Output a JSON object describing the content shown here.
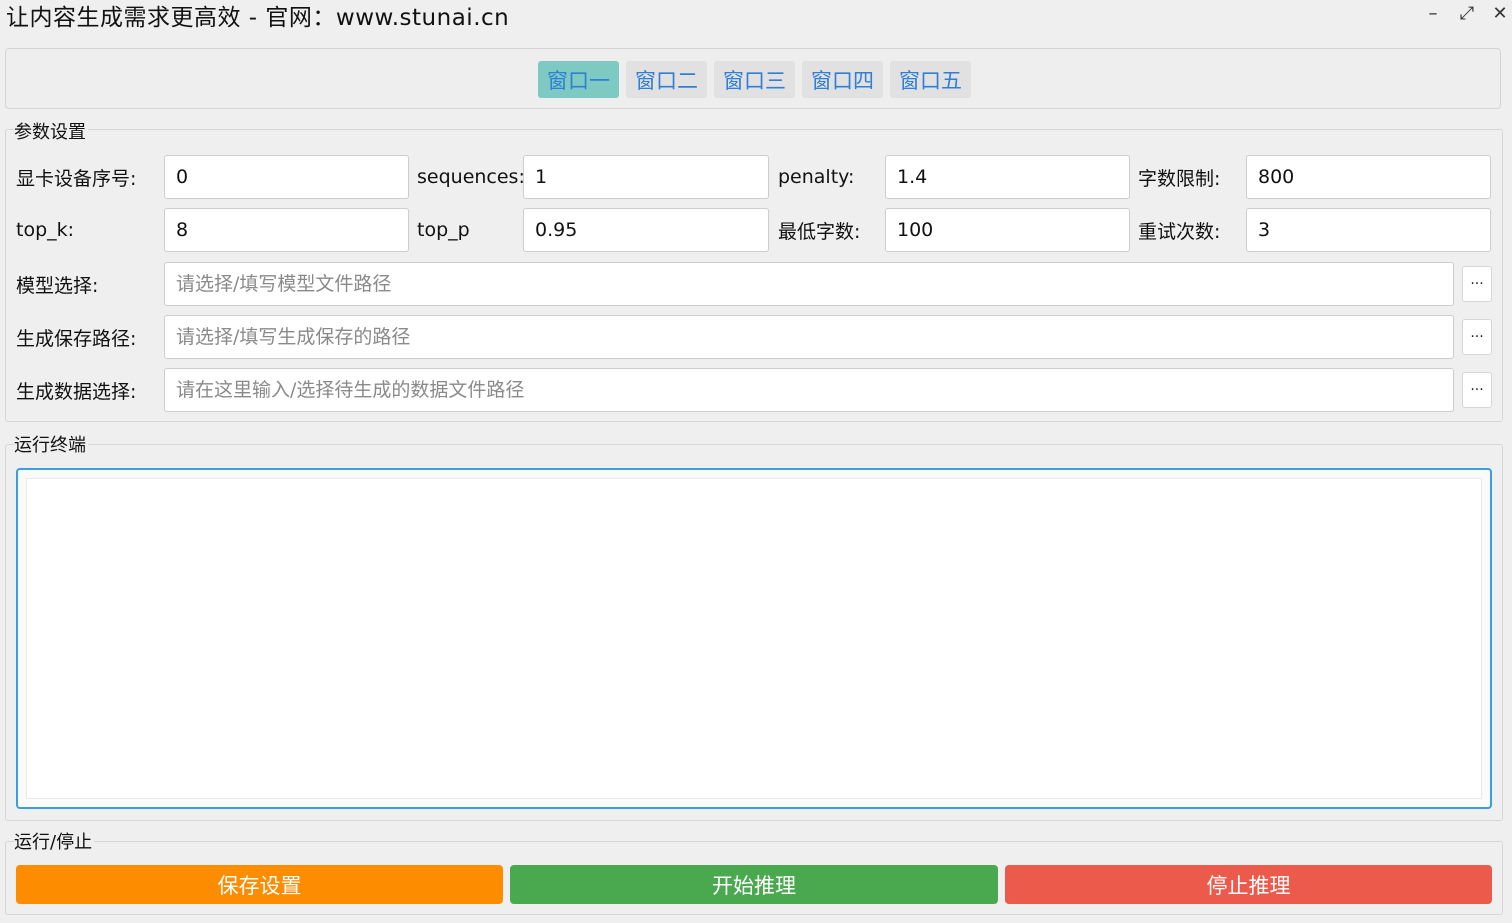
{
  "window": {
    "title": "让内容生成需求更高效  -  官网：www.stunai.cn",
    "controls": {
      "minimize": "–",
      "maximize": "⤢",
      "close": "✕"
    }
  },
  "tabs": [
    {
      "label": "窗口一",
      "active": true
    },
    {
      "label": "窗口二",
      "active": false
    },
    {
      "label": "窗口三",
      "active": false
    },
    {
      "label": "窗口四",
      "active": false
    },
    {
      "label": "窗口五",
      "active": false
    }
  ],
  "params": {
    "section_title": "参数设置",
    "gpu_label": "显卡设备序号:",
    "gpu_value": "0",
    "sequences_label": "sequences:",
    "sequences_value": "1",
    "penalty_label": "penalty:",
    "penalty_value": "1.4",
    "word_limit_label": "字数限制:",
    "word_limit_value": "800",
    "top_k_label": "top_k:",
    "top_k_value": "8",
    "top_p_label": "top_p",
    "top_p_value": "0.95",
    "min_words_label": "最低字数:",
    "min_words_value": "100",
    "retries_label": "重试次数:",
    "retries_value": "3",
    "model_label": "模型选择:",
    "model_placeholder": "请选择/填写模型文件路径",
    "save_path_label": "生成保存路径:",
    "save_path_placeholder": "请选择/填写生成保存的路径",
    "data_label": "生成数据选择:",
    "data_placeholder": "请在这里输入/选择待生成的数据文件路径",
    "browse_label": "···"
  },
  "terminal": {
    "section_title": "运行终端"
  },
  "run": {
    "section_title": "运行/停止",
    "save_label": "保存设置",
    "start_label": "开始推理",
    "stop_label": "停止推理"
  },
  "colors": {
    "active_tab": "#7ecac2",
    "tab_text": "#2f7fd6",
    "save_button": "#fe8c00",
    "start_button": "#4aa84f",
    "stop_button": "#ec5a4b",
    "terminal_border": "#3a9de0"
  }
}
